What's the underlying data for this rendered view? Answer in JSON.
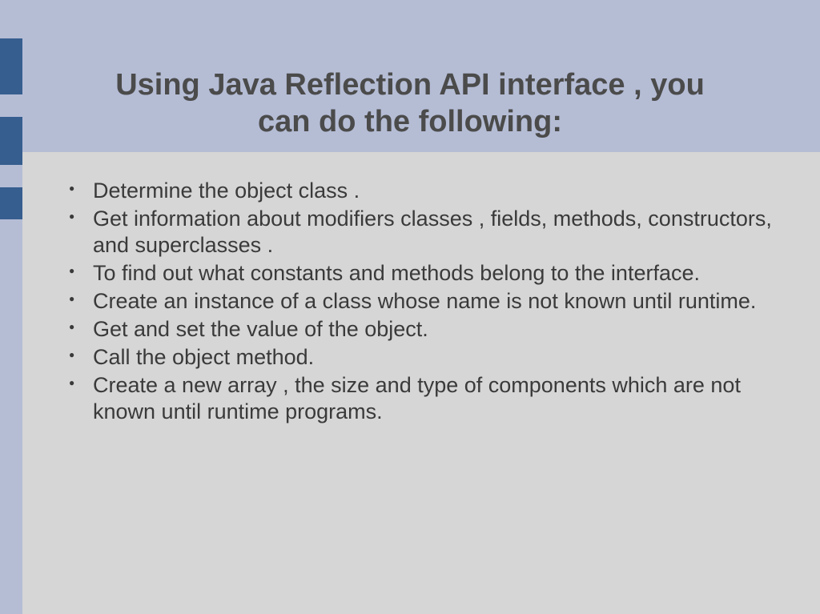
{
  "slide": {
    "title_line1": "Using Java Reflection API interface , you",
    "title_line2": "can do the following:",
    "bullets": [
      "Determine the object class .",
      "Get information about modifiers classes , fields, methods, constructors, and superclasses .",
      "To find out what constants and methods belong to the interface.",
      "Create an instance of a class whose name is not known until runtime.",
      "Get and set the value of the object.",
      "Call the object method.",
      "Create a new array , the size and type of components which are not known until runtime programs."
    ]
  }
}
